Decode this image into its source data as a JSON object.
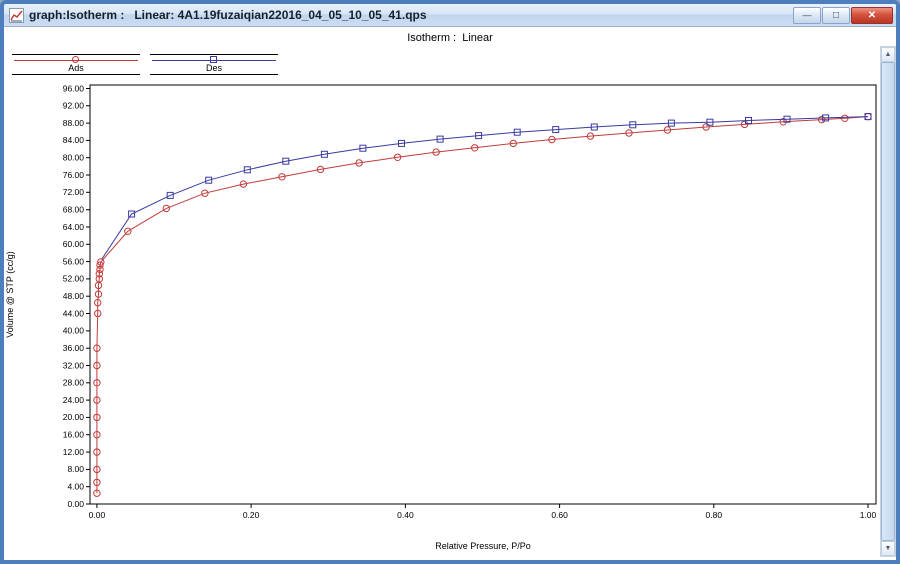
{
  "window": {
    "title": "graph:Isotherm :   Linear: 4A1.19fuzaiqian22016_04_05_10_05_41.qps"
  },
  "icons": {
    "app_icon": "line-chart",
    "minimize": "—",
    "maximize": "□",
    "close": "✕",
    "scroll_up": "▲",
    "scroll_down": "▼"
  },
  "header": {
    "subtitle": "Isotherm :  Linear"
  },
  "legend": [
    {
      "label": "Ads",
      "color": "#c23b3b",
      "marker": "circle"
    },
    {
      "label": "Des",
      "color": "#3a3aa0",
      "marker": "square"
    }
  ],
  "colors": {
    "window_border": "#4d7fbe",
    "ads_series": "#c23b3b",
    "des_series": "#3a3aa0",
    "close_button": "#b93424"
  },
  "chart_data": {
    "type": "line",
    "title": "Isotherm :  Linear",
    "xlabel": "Relative Pressure, P/Po",
    "ylabel": "Volume @ STP (cc/g)",
    "xlim": [
      -0.009,
      1.0104
    ],
    "ylim": [
      0,
      96.8
    ],
    "grid": false,
    "legend_position": "top-left",
    "x_ticks": [
      0.0,
      0.2,
      0.4,
      0.6,
      0.8,
      1.0
    ],
    "x_tick_labels": [
      "0.00",
      "0.20",
      "0.40",
      "0.60",
      "0.80",
      "1.00"
    ],
    "y_ticks": [
      0,
      4,
      8,
      12,
      16,
      20,
      24,
      28,
      32,
      36,
      40,
      44,
      48,
      52,
      56,
      60,
      64,
      68,
      72,
      76,
      80,
      84,
      88,
      92,
      96
    ],
    "series": [
      {
        "name": "Ads",
        "color": "#c23b3b",
        "marker": "circle",
        "points": [
          [
            0.0,
            2.5
          ],
          [
            0.0,
            5.0
          ],
          [
            0.0,
            8.0
          ],
          [
            0.0,
            12.0
          ],
          [
            0.0,
            16.0
          ],
          [
            0.0,
            20.0
          ],
          [
            0.0,
            24.0
          ],
          [
            0.0,
            28.0
          ],
          [
            0.0,
            32.0
          ],
          [
            0.0,
            36.0
          ],
          [
            0.001,
            44.0
          ],
          [
            0.001,
            46.5
          ],
          [
            0.002,
            48.5
          ],
          [
            0.002,
            50.5
          ],
          [
            0.003,
            52.0
          ],
          [
            0.003,
            53.2
          ],
          [
            0.004,
            54.2
          ],
          [
            0.004,
            55.2
          ],
          [
            0.005,
            55.9
          ],
          [
            0.04,
            63.0
          ],
          [
            0.09,
            68.3
          ],
          [
            0.14,
            71.8
          ],
          [
            0.19,
            73.9
          ],
          [
            0.24,
            75.6
          ],
          [
            0.29,
            77.3
          ],
          [
            0.34,
            78.8
          ],
          [
            0.39,
            80.1
          ],
          [
            0.44,
            81.3
          ],
          [
            0.49,
            82.3
          ],
          [
            0.54,
            83.3
          ],
          [
            0.59,
            84.2
          ],
          [
            0.64,
            85.0
          ],
          [
            0.69,
            85.7
          ],
          [
            0.74,
            86.4
          ],
          [
            0.79,
            87.1
          ],
          [
            0.84,
            87.7
          ],
          [
            0.89,
            88.3
          ],
          [
            0.94,
            88.8
          ],
          [
            0.97,
            89.1
          ],
          [
            1.0,
            89.5
          ]
        ]
      },
      {
        "name": "Des",
        "color": "#3a3aa0",
        "marker": "square",
        "line_prefix": [
          [
            0.006,
            56.5
          ]
        ],
        "points": [
          [
            0.045,
            67.0
          ],
          [
            0.095,
            71.3
          ],
          [
            0.145,
            74.8
          ],
          [
            0.195,
            77.2
          ],
          [
            0.245,
            79.2
          ],
          [
            0.295,
            80.8
          ],
          [
            0.345,
            82.2
          ],
          [
            0.395,
            83.3
          ],
          [
            0.445,
            84.3
          ],
          [
            0.495,
            85.1
          ],
          [
            0.545,
            85.9
          ],
          [
            0.595,
            86.5
          ],
          [
            0.645,
            87.1
          ],
          [
            0.695,
            87.6
          ],
          [
            0.745,
            88.0
          ],
          [
            0.795,
            88.2
          ],
          [
            0.845,
            88.6
          ],
          [
            0.895,
            88.9
          ],
          [
            0.945,
            89.2
          ],
          [
            1.0,
            89.5
          ]
        ]
      }
    ]
  }
}
